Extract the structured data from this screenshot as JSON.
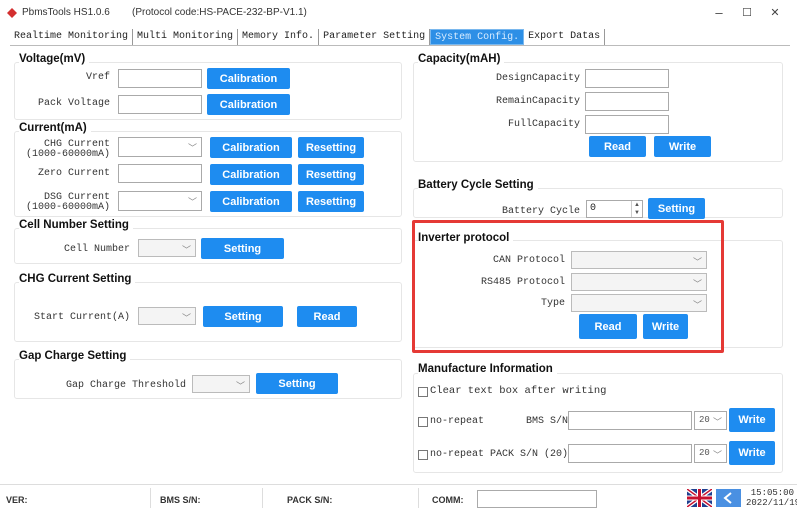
{
  "titlebar": {
    "app_name": "PbmsTools HS1.0.6",
    "protocol_code": "(Protocol code:HS-PACE-232-BP-V1.1)",
    "minimize": "–",
    "maximize": "☐",
    "close": "✕"
  },
  "tabs": [
    {
      "label": "Realtime Monitoring"
    },
    {
      "label": "Multi Monitoring"
    },
    {
      "label": "Memory Info."
    },
    {
      "label": "Parameter Setting"
    },
    {
      "label": "System Config."
    },
    {
      "label": "Export Datas"
    }
  ],
  "voltage": {
    "title": "Voltage(mV)",
    "vref_label": "Vref",
    "pack_voltage_label": "Pack Voltage",
    "vref_value": "",
    "pack_voltage_value": "",
    "calibration_label": "Calibration"
  },
  "current": {
    "title": "Current(mA)",
    "chg_label_1": "CHG Current",
    "chg_label_2": "(1000-60000mA)",
    "zero_label": "Zero Current",
    "dsg_label_1": "DSG Current",
    "dsg_label_2": "(1000-60000mA)",
    "calibration_label": "Calibration",
    "resetting_label": "Resetting"
  },
  "cell_number": {
    "title": "Cell Number Setting",
    "label": "Cell Number",
    "setting_label": "Setting"
  },
  "chg_current": {
    "title": "CHG Current Setting",
    "label": "Start Current(A)",
    "setting_label": "Setting",
    "read_label": "Read"
  },
  "gap_charge": {
    "title": "Gap Charge Setting",
    "label": "Gap Charge Threshold",
    "setting_label": "Setting"
  },
  "capacity": {
    "title": "Capacity(mAH)",
    "design_label": "DesignCapacity",
    "remain_label": "RemainCapacity",
    "full_label": "FullCapacity",
    "read_label": "Read",
    "write_label": "Write"
  },
  "battery_cycle": {
    "title": "Battery Cycle Setting",
    "label": "Battery Cycle",
    "value": "0",
    "setting_label": "Setting"
  },
  "inverter": {
    "title": "Inverter protocol",
    "can_label": "CAN Protocol",
    "rs485_label": "RS485 Protocol",
    "type_label": "Type",
    "read_label": "Read",
    "write_label": "Write"
  },
  "manufacture": {
    "title": "Manufacture Information",
    "clear_label": "Clear text box after writing",
    "norepeat_label": "no-repeat",
    "bms_sn_label": "BMS S/N",
    "pack_sn_label": "PACK S/N (20)",
    "bms_len": "20",
    "pack_len": "20",
    "write_label": "Write"
  },
  "statusbar": {
    "ver_label": "VER:",
    "bms_sn_label": "BMS S/N:",
    "pack_sn_label": "PACK S/N:",
    "comm_label": "COMM:",
    "time": "15:05:00",
    "date": "2022/11/19"
  },
  "colors": {
    "accent_button": "#1e8cf0",
    "active_tab": "#2d8fe6",
    "highlight_box": "#e53935"
  }
}
